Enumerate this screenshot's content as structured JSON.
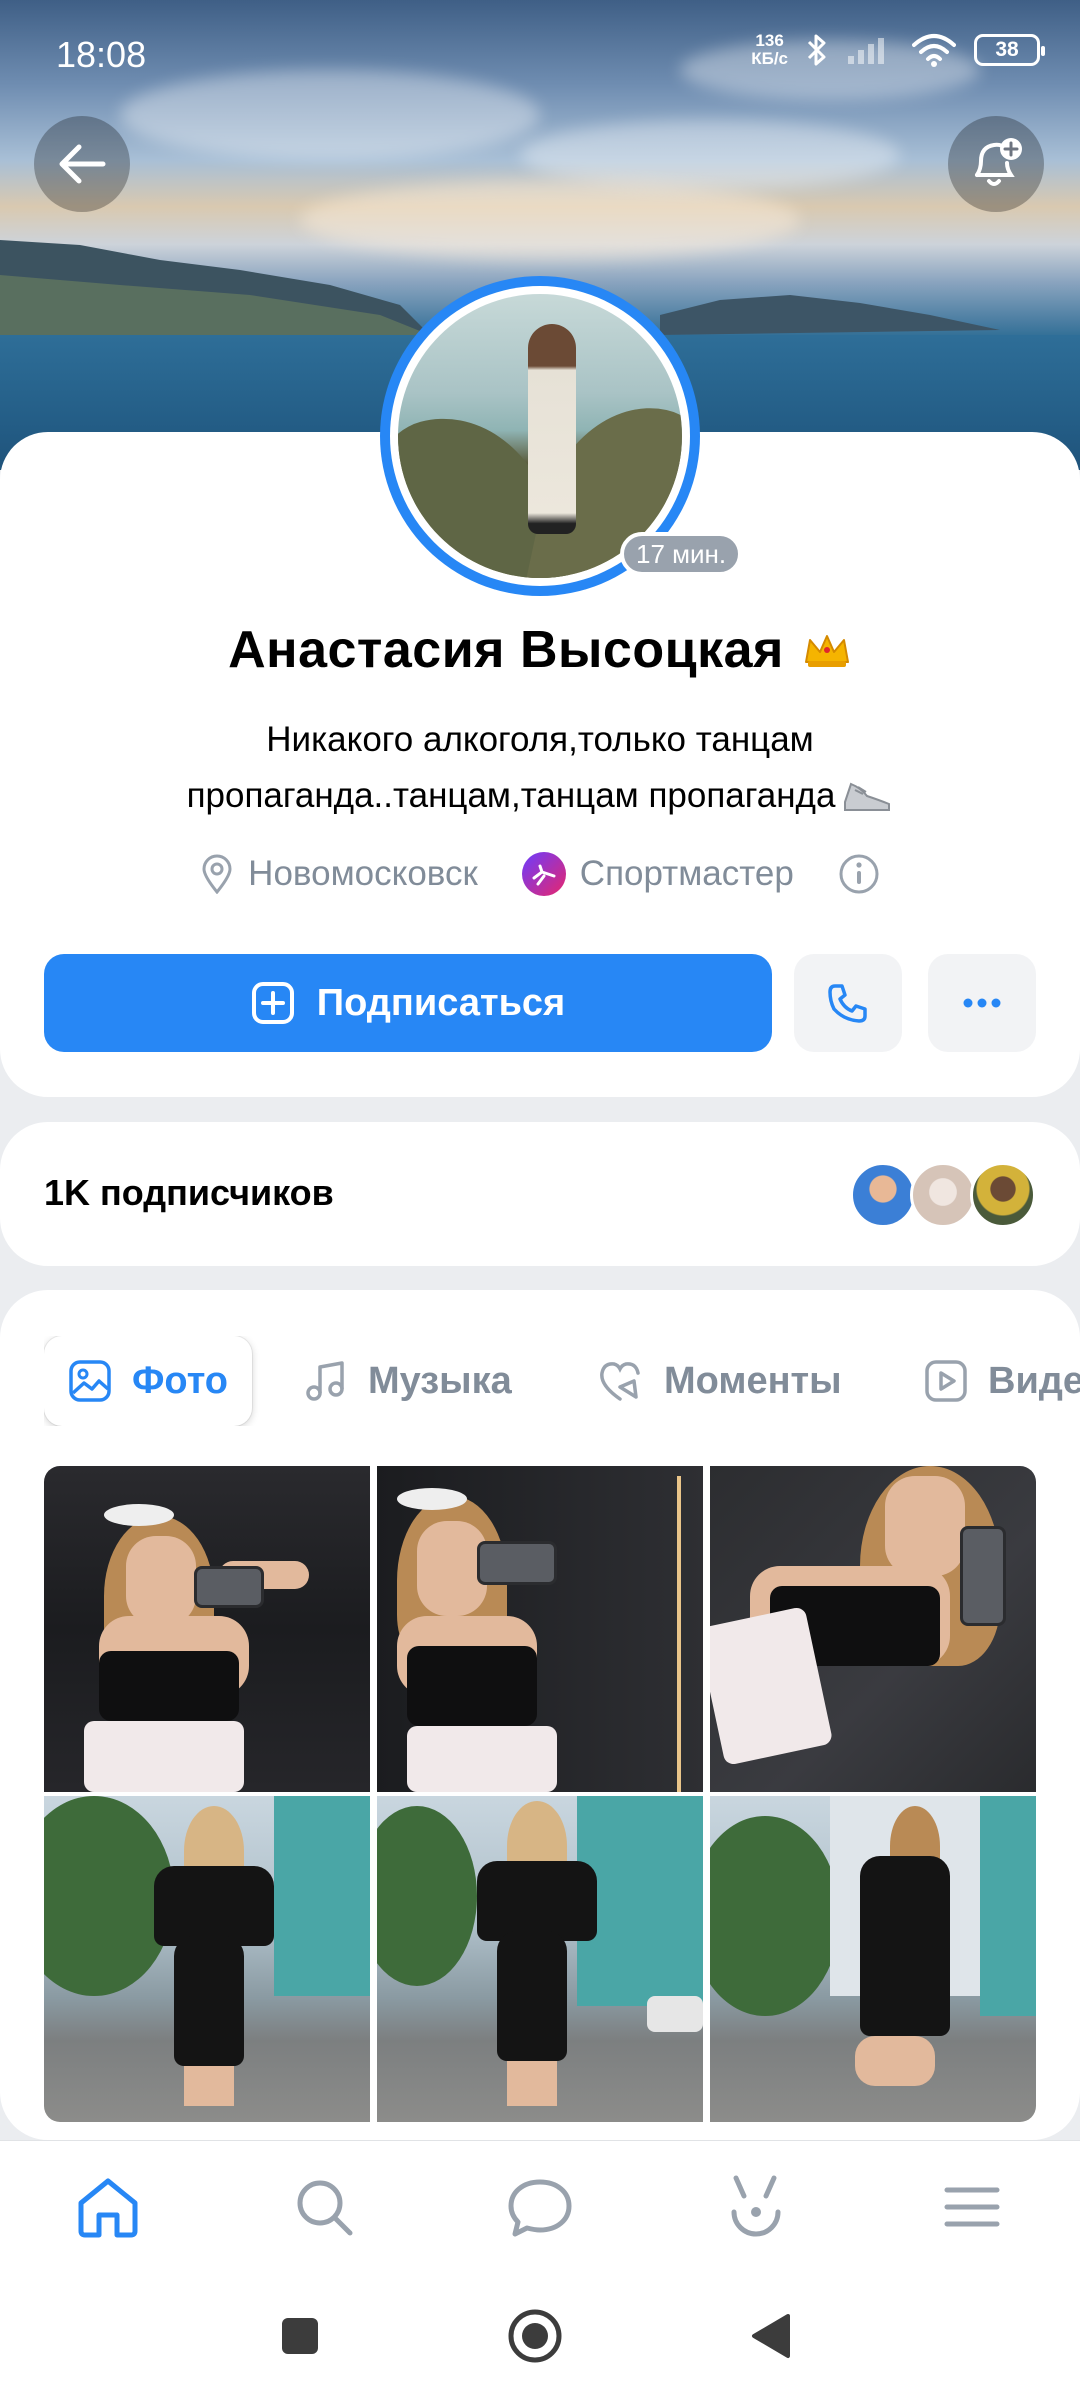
{
  "status_bar": {
    "time": "18:08",
    "net_speed_value": "136",
    "net_speed_unit": "КБ/с",
    "battery": "38"
  },
  "profile": {
    "name": "Анастасия Высоцкая",
    "last_seen": "17 мин.",
    "status_line1": "Никакого алкоголя,только танцам",
    "status_line2": "пропаганда..танцам,танцам пропаганда",
    "city": "Новомосковск",
    "work": "Спортмастер"
  },
  "actions": {
    "subscribe_label": "Подписаться"
  },
  "followers": {
    "count_label": "1K подписчиков"
  },
  "tabs": [
    {
      "label": "Фото",
      "icon": "image-icon",
      "active": true
    },
    {
      "label": "Музыка",
      "icon": "music-icon",
      "active": false
    },
    {
      "label": "Моменты",
      "icon": "moments-icon",
      "active": false
    },
    {
      "label": "Виде",
      "icon": "video-icon",
      "active": false
    }
  ],
  "bottom_nav": [
    "home-icon",
    "search-icon",
    "messages-icon",
    "services-icon",
    "menu-icon"
  ],
  "colors": {
    "accent": "#2787f5",
    "secondary_text": "#818c99",
    "background": "#ebedf0"
  }
}
